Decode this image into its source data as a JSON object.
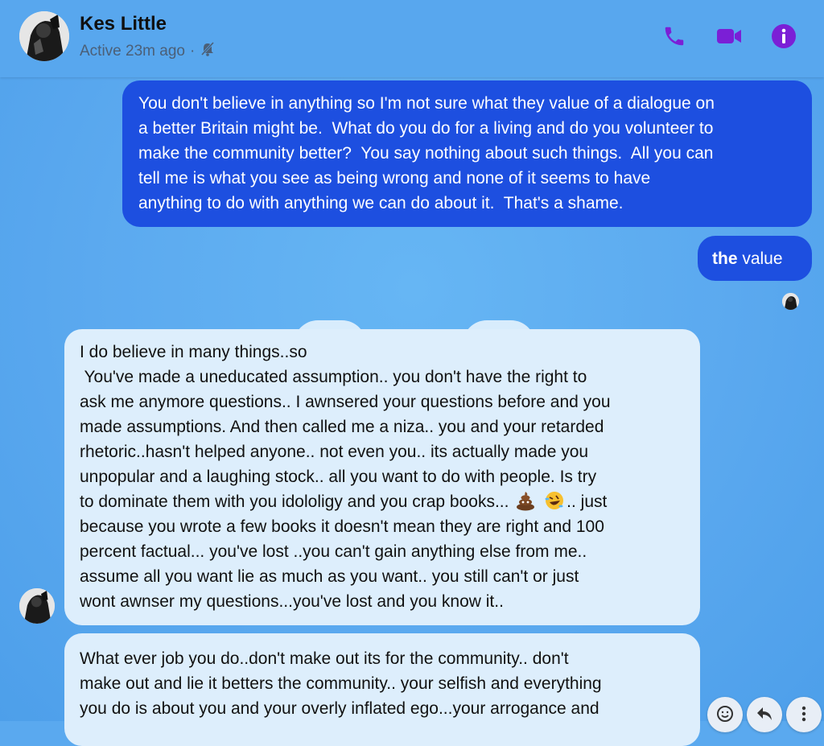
{
  "header": {
    "contact_name": "Kes Little",
    "status_text": "Active 23m ago",
    "status_separator": "·",
    "icons": [
      "phone-icon",
      "video-icon",
      "info-icon",
      "muted-bell-icon"
    ]
  },
  "messages": {
    "sent_1": {
      "lines": [
        "You don't believe in anything so I'm not sure what they value of a dialogue on",
        "a better Britain might be.  What do you do for a living and do you volunteer to",
        "make the community better?  You say nothing about such things.  All you can",
        "tell me is what you see as being wrong and none of it seems to have",
        "anything to do with anything we can do about it.  That's a shame."
      ]
    },
    "sent_2": {
      "bold": "the",
      "rest": " value"
    },
    "recv_1": {
      "lines": [
        "I do believe in many things..so",
        " You've made a uneducated assumption.. you don't have the right to",
        "ask me anymore questions.. I awnsered your questions before and you",
        "made assumptions. And then called me a niza.. you and your retarded",
        "rhetoric..hasn't helped anyone.. not even you.. its actually made you",
        "unpopular and a laughing stock.. all you want to do with people. Is try"
      ],
      "line_7_before_emoji": "to dominate them with you idololigy and you crap books... ",
      "line_7_after_emoji": ".. just",
      "lines_after": [
        "because you wrote a few books it doesn't mean they are right and 100",
        "percent factual... you've lost ..you can't gain anything else from me..",
        "assume all you want lie as much as you want.. you still can't or just",
        "wont awnser my questions...you've lost and you know it.."
      ],
      "emojis": [
        "poop-emoji",
        "rofl-emoji"
      ]
    },
    "recv_2": {
      "lines": [
        "What ever job you do..don't make out its for the community.. don't",
        "make out and lie it betters the community.. your selfish and everything",
        "you do is about you and your overly inflated ego...your arrogance and"
      ]
    }
  },
  "actions": [
    "react-icon",
    "reply-icon",
    "more-icon"
  ],
  "colors": {
    "background": "#5aa9ef",
    "sent_bubble": "#1d4fe0",
    "received_bubble": "#ddeefc",
    "accent": "#7b1fd6"
  }
}
